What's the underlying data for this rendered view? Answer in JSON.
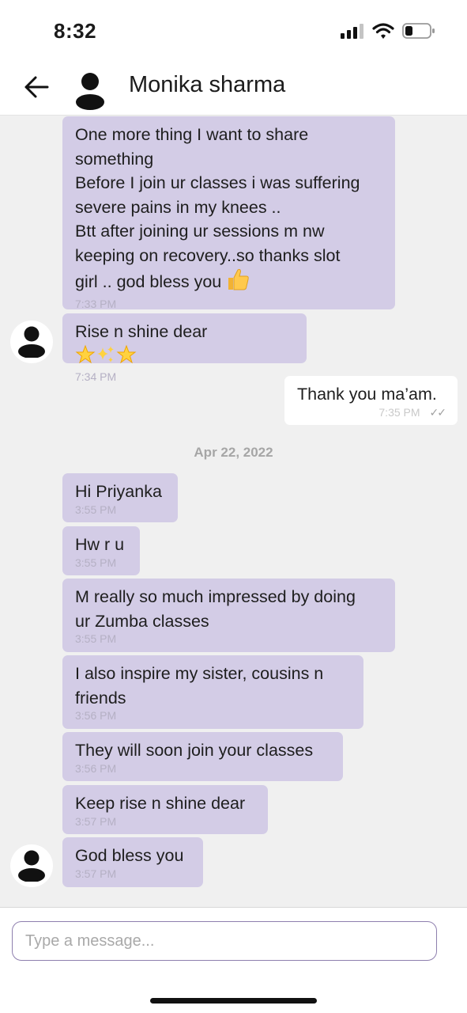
{
  "status_bar": {
    "time": "8:32"
  },
  "header": {
    "contact_name": "Monika sharma"
  },
  "messages": [
    {
      "text": "One more thing I want to share\nsomething\nBefore I join ur classes i was suffering\nsevere pains in my knees ..\nBtt after joining ur sessions m nw\nkeeping on recovery..so thanks slot\ngirl .. god bless you",
      "emoji": [
        "thumbs-up-emoji"
      ],
      "time": "7:33 PM"
    },
    {
      "text": "Rise n shine dear",
      "emoji": [
        "glowing-star-emoji",
        "sparkles-emoji",
        "glowing-star-emoji"
      ],
      "time": "7:34 PM"
    },
    {
      "text": "Thank you ma’am.",
      "time": "7:35 PM",
      "outgoing": true
    },
    {
      "text": "Hi Priyanka",
      "time": "3:55 PM"
    },
    {
      "text": "Hw r u",
      "time": "3:55 PM"
    },
    {
      "text": "M really so much impressed by doing\nur Zumba classes",
      "time": "3:55 PM"
    },
    {
      "text": "I also inspire my sister,  cousins n\nfriends",
      "time": "3:56 PM"
    },
    {
      "text": "They will soon join your classes",
      "time": "3:56 PM"
    },
    {
      "text": "Keep rise n shine dear",
      "time": "3:57 PM"
    },
    {
      "text": "God bless you",
      "time": "3:57 PM"
    }
  ],
  "date_separator": "Apr 22, 2022",
  "input": {
    "placeholder": "Type a message..."
  },
  "icons": {
    "back": "arrow-left-icon",
    "avatar": "person-avatar-icon",
    "signal": "cellular-signal-icon",
    "wifi": "wifi-icon",
    "battery": "battery-icon",
    "read_receipt": "double-check-icon"
  },
  "colors": {
    "incoming_bubble": "#d3cce6",
    "outgoing_bubble": "#ffffff",
    "chat_background": "#f0f0f0",
    "input_border": "#8e7fae"
  }
}
